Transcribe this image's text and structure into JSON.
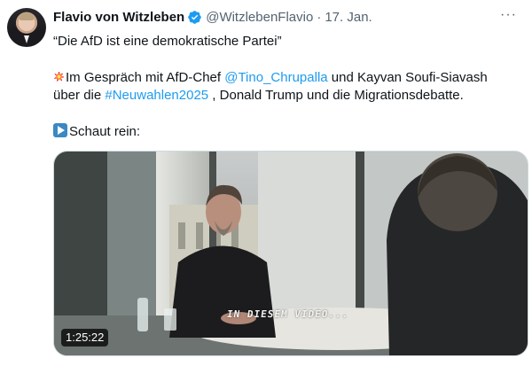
{
  "author": {
    "name": "Flavio von Witzleben",
    "handle": "@WitzlebenFlavio",
    "separator": "·",
    "date": "17. Jan.",
    "verified": true
  },
  "more_menu": {
    "label": "···"
  },
  "text": {
    "quote": "“Die AfD ist eine demokratische Partei”",
    "p1_before": "Im Gespräch mit AfD-Chef ",
    "mention": "@Tino_Chrupalla",
    "p1_after": "  und Kayvan Soufi-Siavash",
    "p2_before": "über die ",
    "hashtag": "#Neuwahlen2025",
    "p2_after": " , Donald Trump und die Migrationsdebatte.",
    "cta": "Schaut rein:"
  },
  "media": {
    "duration": "1:25:22",
    "overlay_text": "IN DIESEM VIDEO..."
  },
  "colors": {
    "accent": "#1d9bf0",
    "text": "#0f1419",
    "secondary": "#536471",
    "border": "#cfd9de"
  },
  "icons": {
    "verified": "verified-badge-icon",
    "burst": "collision-emoji-icon",
    "play": "play-button-emoji-icon",
    "more": "more-horizontal-icon"
  }
}
